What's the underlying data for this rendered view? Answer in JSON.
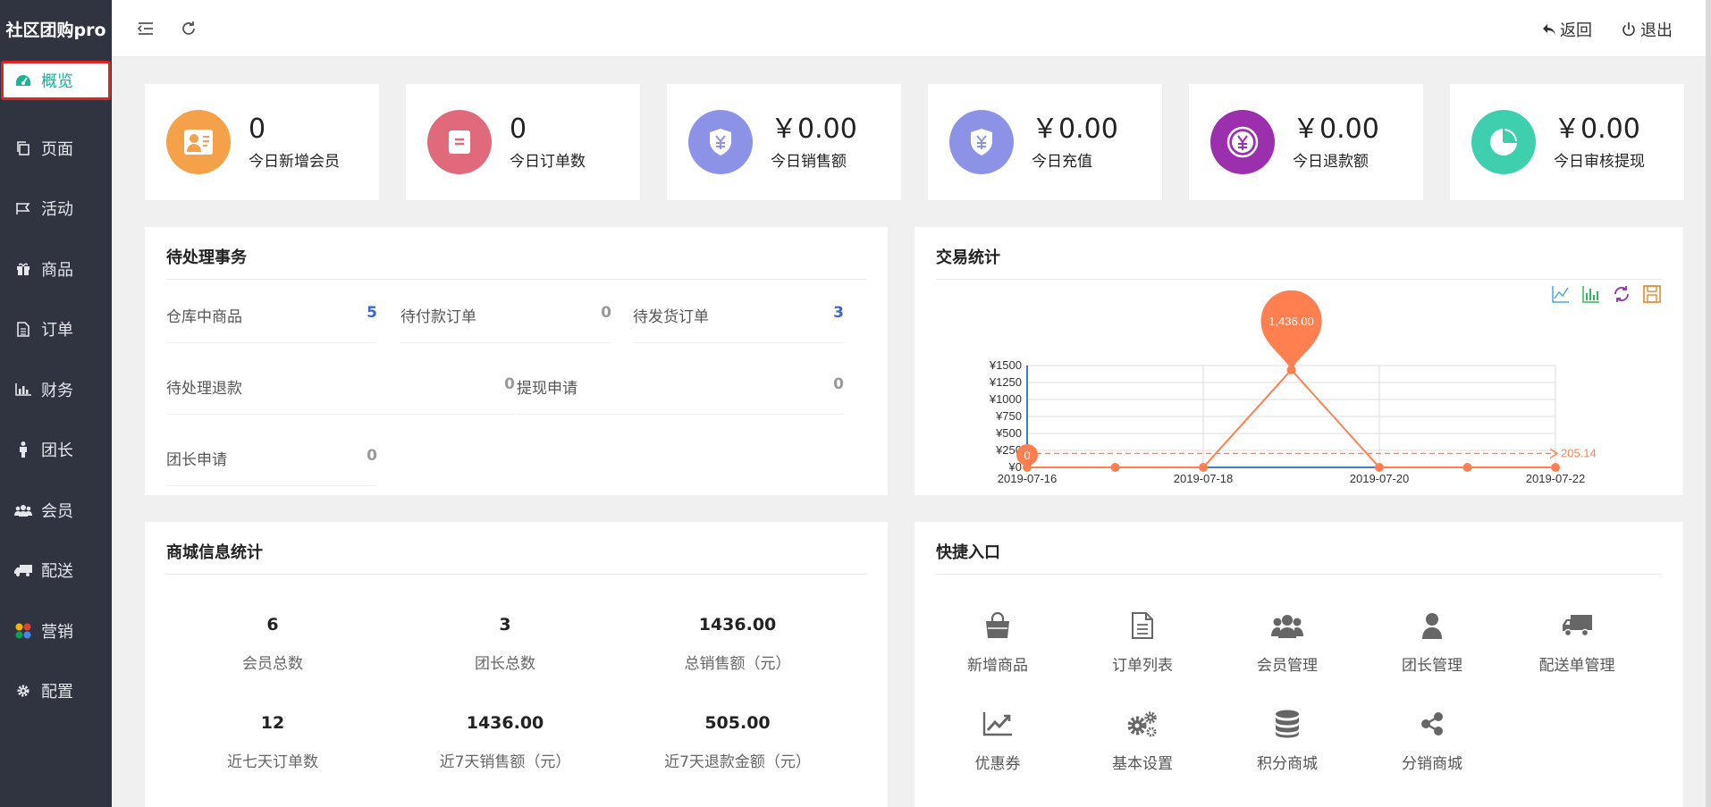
{
  "app": {
    "brand": "社区团购pro"
  },
  "sidebar": {
    "items": [
      {
        "label": "概览",
        "icon": "dashboard-icon"
      },
      {
        "label": "页面",
        "icon": "copy-icon"
      },
      {
        "label": "活动",
        "icon": "flag-icon"
      },
      {
        "label": "商品",
        "icon": "gift-icon"
      },
      {
        "label": "订单",
        "icon": "file-icon"
      },
      {
        "label": "财务",
        "icon": "bar-chart-icon"
      },
      {
        "label": "团长",
        "icon": "male-icon"
      },
      {
        "label": "会员",
        "icon": "users-icon"
      },
      {
        "label": "配送",
        "icon": "truck-icon"
      },
      {
        "label": "营销",
        "icon": "circles-icon"
      },
      {
        "label": "配置",
        "icon": "gear-icon"
      }
    ]
  },
  "topbar": {
    "back_label": "返回",
    "logout_label": "退出"
  },
  "stats": [
    {
      "value": "0",
      "label": "今日新增会员",
      "color": "#f4a14a",
      "icon": "member-card-icon"
    },
    {
      "value": "0",
      "label": "今日订单数",
      "color": "#e06a7b",
      "icon": "order-icon"
    },
    {
      "value": "￥0.00",
      "label": "今日销售额",
      "color": "#8c93e6",
      "icon": "yen-shield-icon"
    },
    {
      "value": "￥0.00",
      "label": "今日充值",
      "color": "#8c93e6",
      "icon": "yen-shield-icon"
    },
    {
      "value": "￥0.00",
      "label": "今日退款额",
      "color": "#9b2fae",
      "icon": "yen-circle-icon"
    },
    {
      "value": "￥0.00",
      "label": "今日审核提现",
      "color": "#3ecfae",
      "icon": "pie-icon"
    }
  ],
  "pending": {
    "title": "待处理事务",
    "items": [
      {
        "label": "仓库中商品",
        "value": "5"
      },
      {
        "label": "待付款订单",
        "value": "0"
      },
      {
        "label": "待发货订单",
        "value": "3"
      },
      {
        "label": "待处理退款",
        "value": "0"
      },
      {
        "label": "提现申请",
        "value": "0"
      },
      {
        "label": "团长申请",
        "value": "0"
      }
    ]
  },
  "trade": {
    "title": "交易统计",
    "tools": [
      "line-chart-icon",
      "bar-chart-icon",
      "refresh-icon",
      "save-icon"
    ]
  },
  "chart_data": {
    "type": "line",
    "x": [
      "2019-07-16",
      "2019-07-17",
      "2019-07-18",
      "2019-07-19",
      "2019-07-20",
      "2019-07-21",
      "2019-07-22"
    ],
    "x_tick_labels": [
      "2019-07-16",
      "2019-07-18",
      "2019-07-20",
      "2019-07-22"
    ],
    "series": [
      {
        "values": [
          0,
          0,
          0,
          1436,
          0,
          0,
          0
        ],
        "color": "#ff7f50"
      }
    ],
    "y_tick_labels": [
      "¥0",
      "¥250",
      "¥500",
      "¥750",
      "¥1000",
      "¥1250",
      "¥1500"
    ],
    "ylim": [
      0,
      1500
    ],
    "max_label": "1,436.00",
    "min_label": "0",
    "average_label": "205.14",
    "average": 205.14,
    "grid": true
  },
  "mall": {
    "title": "商城信息统计",
    "stats": [
      {
        "value": "6",
        "label": "会员总数"
      },
      {
        "value": "3",
        "label": "团长总数"
      },
      {
        "value": "1436.00",
        "label": "总销售额（元）"
      },
      {
        "value": "12",
        "label": "近七天订单数"
      },
      {
        "value": "1436.00",
        "label": "近7天销售额（元）"
      },
      {
        "value": "505.00",
        "label": "近7天退款金额（元）"
      }
    ]
  },
  "quick": {
    "title": "快捷入口",
    "items": [
      {
        "label": "新增商品",
        "icon": "shopping-bag-icon"
      },
      {
        "label": "订单列表",
        "icon": "file-text-icon"
      },
      {
        "label": "会员管理",
        "icon": "users-icon"
      },
      {
        "label": "团长管理",
        "icon": "user-icon"
      },
      {
        "label": "配送单管理",
        "icon": "truck-icon"
      },
      {
        "label": "优惠券",
        "icon": "trend-chart-icon"
      },
      {
        "label": "基本设置",
        "icon": "gears-icon"
      },
      {
        "label": "积分商城",
        "icon": "database-icon"
      },
      {
        "label": "分销商城",
        "icon": "share-icon"
      }
    ]
  }
}
